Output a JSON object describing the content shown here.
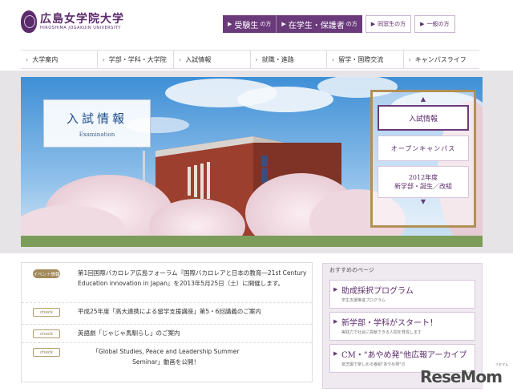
{
  "logo": {
    "name_jp": "広島女学院大学",
    "name_en": "HIROSHIMA JOGAKUIN UNIVERSITY"
  },
  "audience_nav": [
    {
      "label": "受験生",
      "suffix": "の方"
    },
    {
      "label": "在学生・保護者",
      "suffix": "の方"
    },
    {
      "label": "同窓生の方"
    },
    {
      "label": "一般の方"
    }
  ],
  "global_nav": [
    "大学案内",
    "学部・学科・大学院",
    "入試情報",
    "就職・進路",
    "留学・国際交流",
    "キャンパスライフ"
  ],
  "hero": {
    "title_jp": "入試情報",
    "title_en": "Examination",
    "menu": [
      "入試情報",
      "オープンキャンパス",
      "2012年度",
      "新学部・誕生／改組"
    ]
  },
  "news": [
    {
      "tag": "イベント情報",
      "text": "第1回国際バカロレア広島フォーラム『国際バカロレアと日本の教育―21st Century Education innovation in Japan』を2013年5月25日（土）に開催します。"
    },
    {
      "tag": "check",
      "text": "平成25年度「高大連携による留学支援講座」第5・6回講義のご案内"
    },
    {
      "tag": "check",
      "text": "英語劇「じゃじゃ馬馴らし」のご案内"
    },
    {
      "tag": "check",
      "text": "「Global Studies, Peace and Leadership Summer Seminar」動画を公開！"
    }
  ],
  "recommend": {
    "title": "おすすめのページ",
    "cards": [
      {
        "main": "助成採択プログラム",
        "sub": "学生支援推進プログラム"
      },
      {
        "main": "新学部・学科がスタート！",
        "sub": "実践力で社会に貢献できる人間を育成します"
      },
      {
        "main": "CM・\"あやめ発\"他広報アーカイブ",
        "sub": "祇芝園で楽しめる番組\"あやめ発\"の"
      }
    ]
  },
  "watermark": {
    "text": "ReseMom",
    "mini": "リセマム"
  },
  "colors": {
    "brand_purple": "#6b3a7b",
    "gold": "#b28f53",
    "title_blue": "#1d4b8f"
  }
}
